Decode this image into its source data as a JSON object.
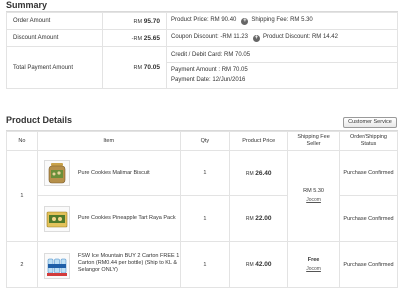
{
  "summary": {
    "title": "Summary",
    "order_amount": {
      "label": "Order Amount",
      "currency": "RM",
      "value": "95.70",
      "product_price": "Product Price: RM 90.40",
      "shipping_fee": "Shipping Fee: RM 5.30"
    },
    "discount_amount": {
      "label": "Discount Amount",
      "currency": "-RM",
      "value": "25.65",
      "coupon_discount": "Coupon Discount: -RM 11.23",
      "product_discount": "Product Discount: RM 14.42"
    },
    "total_payment": {
      "label": "Total Payment Amount",
      "currency": "RM",
      "value": "70.05",
      "card": "Credit / Debit Card: RM 70.05",
      "payment_amount": "Payment Amount : RM 70.05",
      "payment_date": "Payment Date: 12/Jun/2016"
    },
    "plus_symbol": "+"
  },
  "product_details": {
    "title": "Product Details",
    "customer_service_label": "Customer Service",
    "columns": {
      "no": "No",
      "item": "Item",
      "qty": "Qty",
      "product_price": "Product Price",
      "shipping_line1": "Shipping Fee",
      "shipping_line2": "Seller",
      "status_line1": "Order/Shipping",
      "status_line2": "Status"
    },
    "groups": [
      {
        "no": "1",
        "shipping_fee": "RM 5.30",
        "seller": "Jocom"
      },
      {
        "no": "2",
        "shipping_fee": "Free",
        "seller": "Jocom"
      }
    ],
    "rows": [
      {
        "name": "Pure Cookies Malimar Biscuit",
        "qty": "1",
        "currency": "RM",
        "price": "26.40",
        "status": "Purchase Confirmed",
        "thumb_icon": "cookie-jar-icon"
      },
      {
        "name": "Pure Cookies Pineapple Tart Raya Pack",
        "qty": "1",
        "currency": "RM",
        "price": "22.00",
        "status": "Purchase Confirmed",
        "thumb_icon": "cookie-box-icon"
      },
      {
        "name": "FSW Ice Mountain BUY 2 Carton FREE 1 Carton (RM0.44 per bottle) (Ship to KL & Selangor ONLY)",
        "qty": "1",
        "currency": "RM",
        "price": "42.00",
        "status": "Purchase Confirmed",
        "thumb_icon": "water-bottle-icon"
      }
    ]
  },
  "colors": {
    "accent_red": "#d0021b",
    "status_blue": "#2a6fb5"
  }
}
